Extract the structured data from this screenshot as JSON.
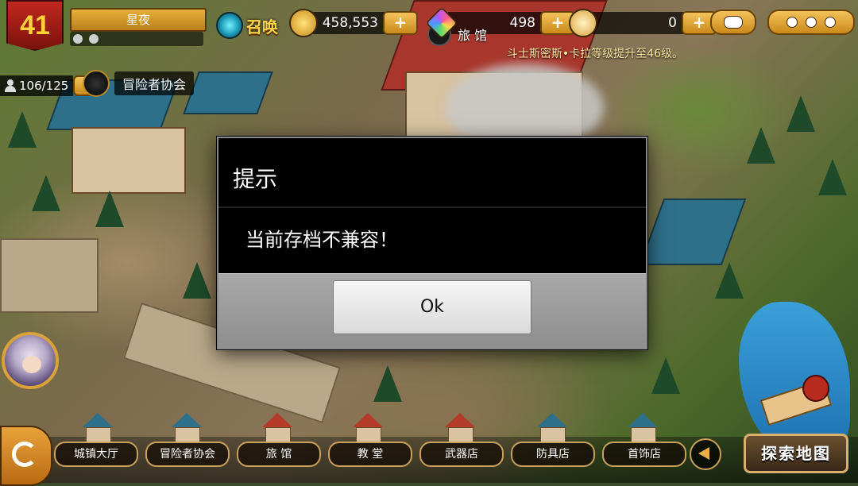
{
  "player": {
    "level": "41",
    "name": "星夜"
  },
  "top_bar": {
    "summon_label": "召唤",
    "gold": "458,553",
    "crystals": "498",
    "third_currency": "0",
    "plus": "+"
  },
  "location": "旅 馆",
  "broadcast": "斗士斯密斯•卡拉等级提升至46级。",
  "stamina": "106/125",
  "guild_label": "冒险者协会",
  "dialog": {
    "title": "提示",
    "message": "当前存档不兼容！",
    "ok_label": "Ok"
  },
  "bottom_nav": {
    "items": [
      {
        "label": "城镇大厅"
      },
      {
        "label": "冒险者协会"
      },
      {
        "label": "旅 馆"
      },
      {
        "label": "教 堂"
      },
      {
        "label": "武器店"
      },
      {
        "label": "防具店"
      },
      {
        "label": "首饰店"
      }
    ],
    "explore_label": "探索地图"
  },
  "colors": {
    "accent_gold": "#e9b04a",
    "level_red": "#c0281e",
    "dialog_bg": "#000000",
    "dialog_footer": "#9a9a9a"
  },
  "icons": [
    "summon-icon",
    "gold-coin-icon",
    "crystal-icon",
    "feather-icon",
    "chat-icon",
    "more-icon",
    "location-icon",
    "person-icon",
    "guild-icon",
    "return-icon",
    "scroll-left-icon",
    "map-scroll-icon"
  ]
}
